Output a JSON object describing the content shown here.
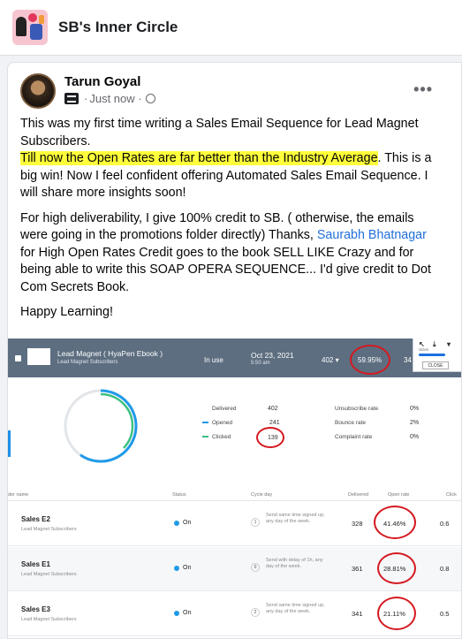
{
  "group": {
    "title": "SB's Inner Circle"
  },
  "post": {
    "author": "Tarun Goyal",
    "timestamp": "Just now",
    "more": "•••",
    "paragraph1": {
      "line1": "This was my first time writing a Sales Email Sequence for Lead Magnet Subscribers.",
      "highlight": "Till now the Open Rates are far better than the Industry Average",
      "rest": ". This is a big win! Now I feel confident offering Automated Sales Email Sequence. I will share more insights soon!"
    },
    "paragraph2": {
      "before": "For high deliverability, I give 100% credit to SB. ( otherwise, the emails were going in the promotions folder directly)  Thanks, ",
      "link": "Saurabh Bhatnagar",
      "after": "for High Open Rates Credit goes to the book SELL LIKE Crazy and for being able to write this SOAP OPERA SEQUENCE... I'd give credit to Dot Com Secrets Book."
    },
    "paragraph3": "Happy Learning!"
  },
  "screenshot": {
    "sequence_name": "Lead Magnet ( HyaPen Ebook )",
    "sequence_list": "Lead Magnet Subscribers",
    "status": "In use",
    "date": "Oct 23, 2021",
    "time": "5:50 am",
    "count": "402",
    "open_rate": "59.95%",
    "partial": "34",
    "popup_label": "Sizes",
    "popup_close": "CLOSE",
    "stats": [
      {
        "label": "Delivered",
        "value": "402"
      },
      {
        "label": "Opened",
        "value": "241"
      },
      {
        "label": "Clicked",
        "value": "139"
      }
    ],
    "rates": [
      {
        "label": "Unsubscribe rate",
        "value": "0%"
      },
      {
        "label": "Bounce rate",
        "value": "2%"
      },
      {
        "label": "Complaint rate",
        "value": "0%"
      }
    ],
    "headers": {
      "name": "der name",
      "status": "Status",
      "cycle": "Cycle day",
      "delivered": "Delivered",
      "open": "Open rate",
      "click": "Click"
    },
    "rows": [
      {
        "name": "Sales E2",
        "list": "Lead Magnet Subscribers",
        "status": "On",
        "day": "1",
        "cycle": "Send same time signed up, any day of the week.",
        "delivered": "328",
        "open_rate": "41.46%",
        "click": "0.6"
      },
      {
        "name": "Sales E1",
        "list": "Lead Magnet Subscribers",
        "status": "On",
        "day": "0",
        "cycle": "Send with delay of 1h, any day of the week.",
        "delivered": "361",
        "open_rate": "28.81%",
        "click": "0.8"
      },
      {
        "name": "Sales E3",
        "list": "Lead Magnet Subscribers",
        "status": "On",
        "day": "2",
        "cycle": "Send same time signed up, any day of the week.",
        "delivered": "341",
        "open_rate": "21.11%",
        "click": "0.5"
      }
    ]
  },
  "colors": {
    "highlight": "#ffff3b",
    "link": "#216fdb",
    "annotation": "#d51920",
    "opened": "#1f9ae8",
    "clicked": "#3cc081"
  }
}
